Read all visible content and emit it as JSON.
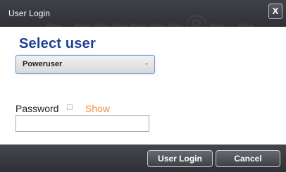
{
  "window": {
    "title": "User Login",
    "close_icon": "close-icon",
    "close_glyph": "X"
  },
  "user_selection": {
    "heading": "Select user",
    "selected_user": "Poweruser",
    "dropdown_icon": "chevron-down-icon"
  },
  "password": {
    "label": "Password",
    "show_label": "Show",
    "value": ""
  },
  "footer": {
    "login_label": "User Login",
    "cancel_label": "Cancel"
  },
  "colors": {
    "title_bar": "#2f3136",
    "heading": "#1d3f95",
    "show_link": "#f0924a",
    "select_border": "#6f9fe0"
  }
}
